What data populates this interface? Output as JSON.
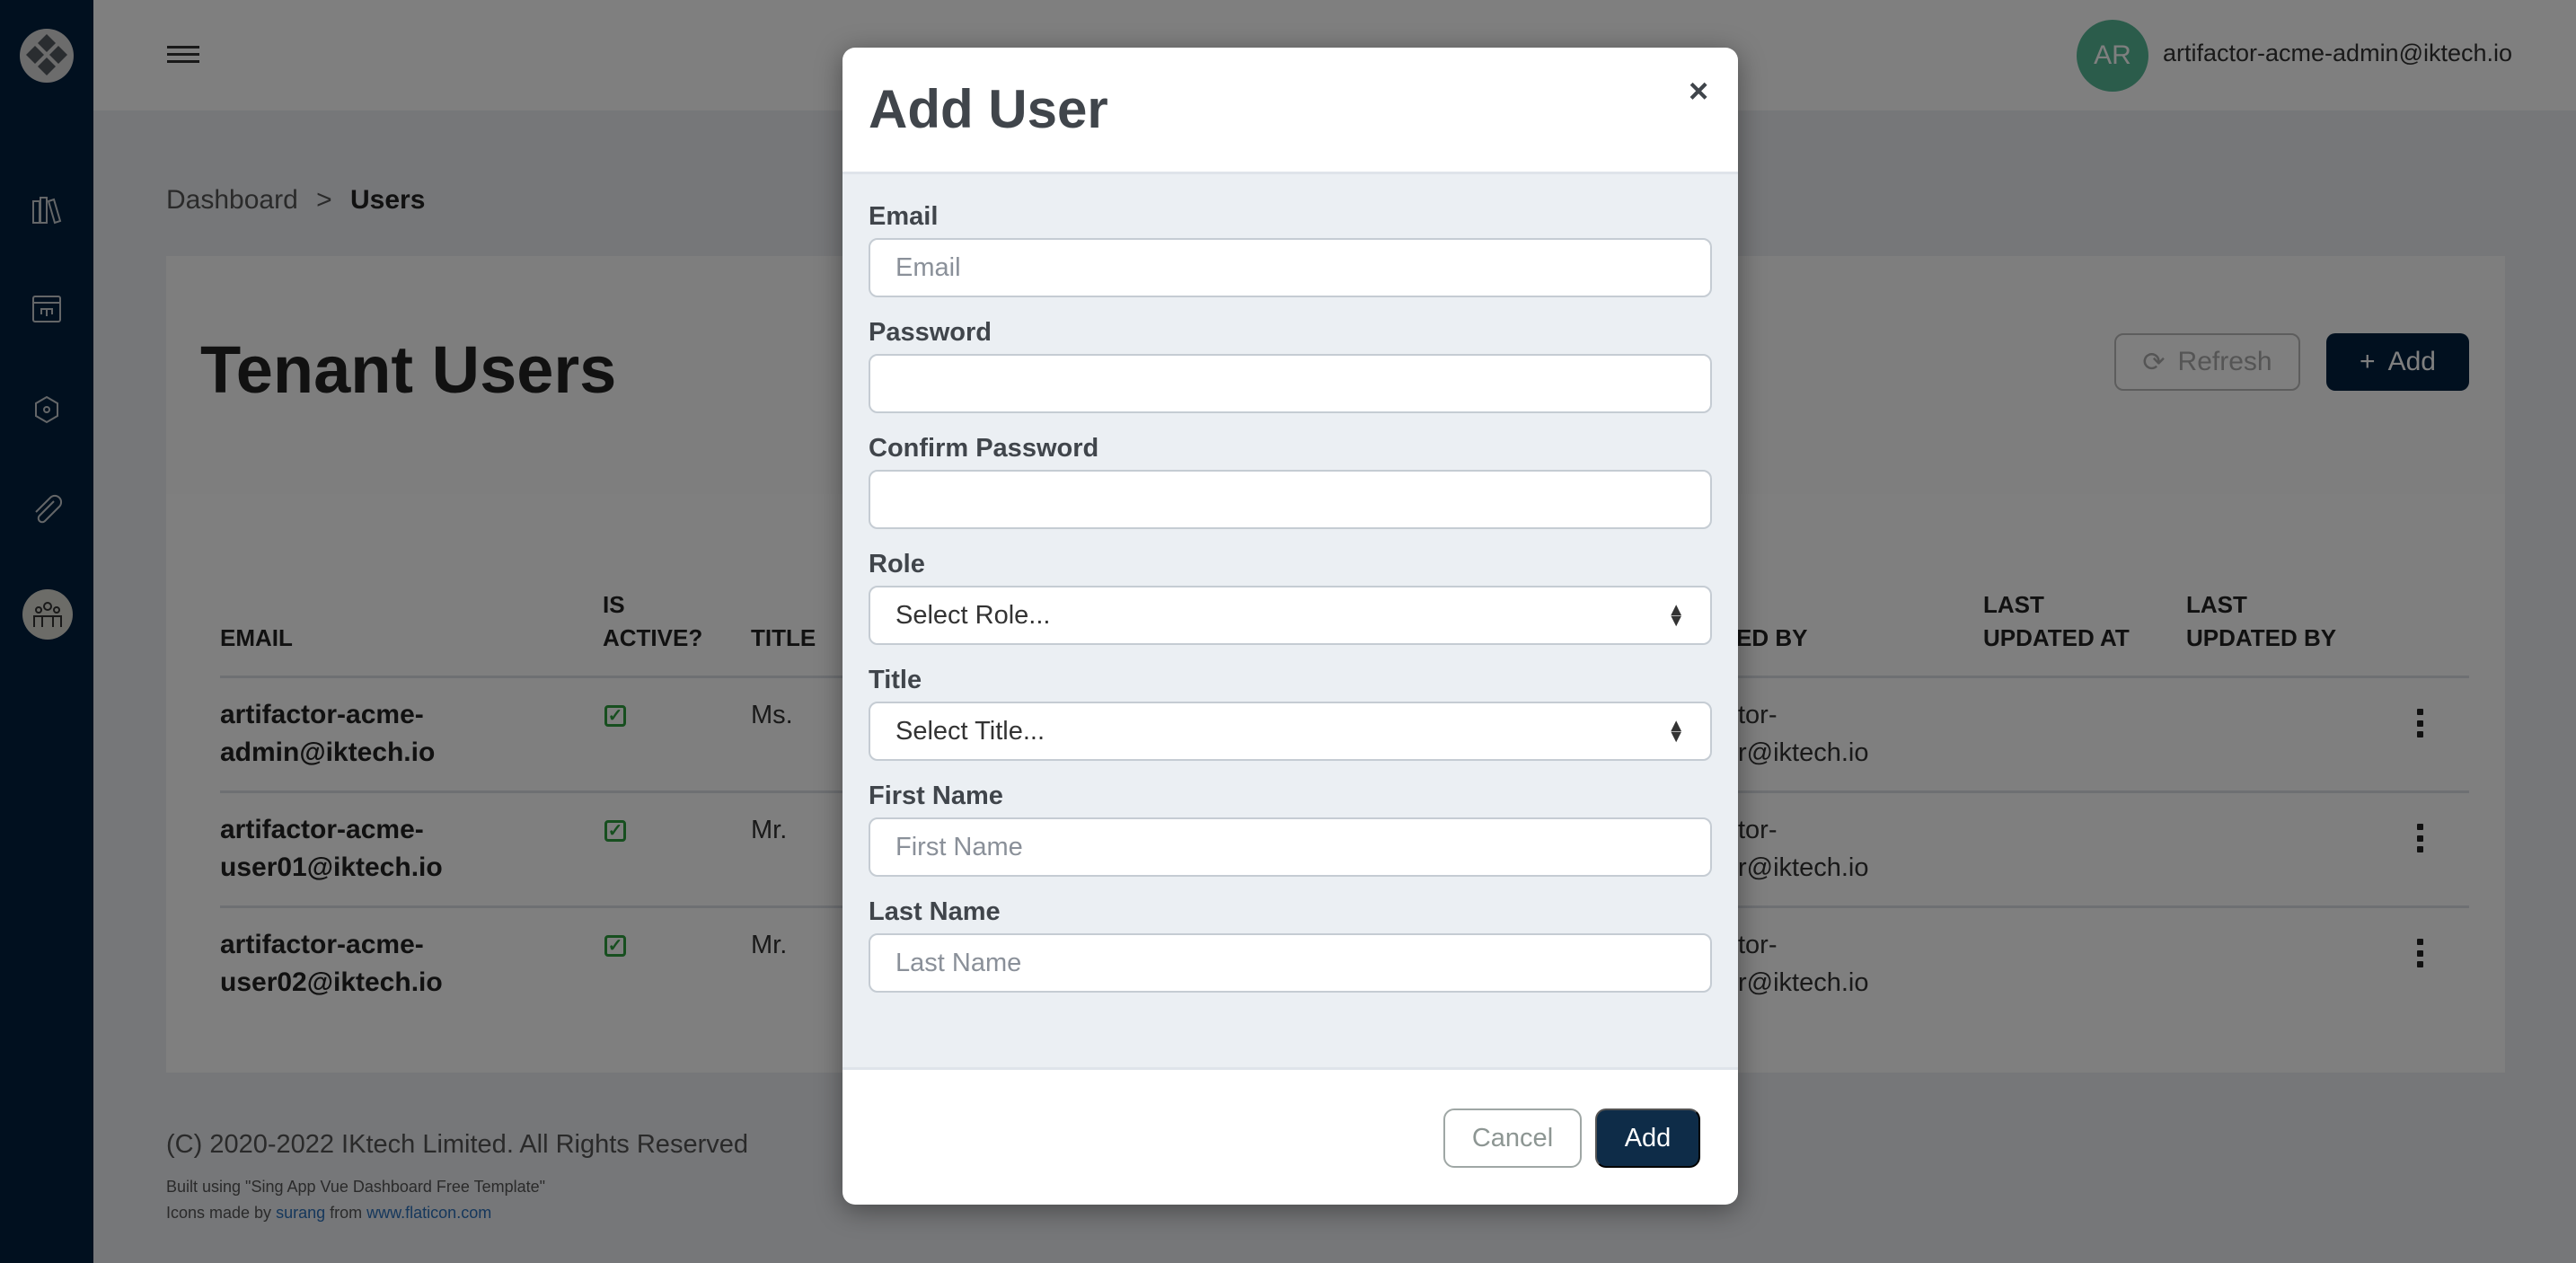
{
  "header": {
    "avatar_initials": "AR",
    "user_email": "artifactor-acme-admin@iktech.io"
  },
  "sidebar": {
    "items": [
      {
        "icon": "books-icon"
      },
      {
        "icon": "workflow-window-icon"
      },
      {
        "icon": "network-cube-icon"
      },
      {
        "icon": "paperclip-icon"
      },
      {
        "icon": "users-group-icon",
        "active": true
      }
    ]
  },
  "breadcrumb": {
    "parent": "Dashboard",
    "separator": ">",
    "current": "Users"
  },
  "page": {
    "title": "Tenant Users",
    "refresh_label": "Refresh",
    "add_label": "Add"
  },
  "table": {
    "headers": {
      "email": "EMAIL",
      "is_active_1": "IS",
      "is_active_2": "ACTIVE?",
      "title": "TITLE",
      "created_by_partial": "ED BY",
      "last_updated_at_1": "LAST",
      "last_updated_at_2": "UPDATED AT",
      "last_updated_by_1": "LAST",
      "last_updated_by_2": "UPDATED BY"
    },
    "rows": [
      {
        "email_1": "artifactor-acme-",
        "email_2": "admin@iktech.io",
        "active": true,
        "title": "Ms.",
        "created_1": "tor-",
        "created_2": "r@iktech.io"
      },
      {
        "email_1": "artifactor-acme-",
        "email_2": "user01@iktech.io",
        "active": true,
        "title": "Mr.",
        "created_1": "tor-",
        "created_2": "r@iktech.io"
      },
      {
        "email_1": "artifactor-acme-",
        "email_2": "user02@iktech.io",
        "active": true,
        "title": "Mr.",
        "created_1": "tor-",
        "created_2": "r@iktech.io"
      }
    ]
  },
  "footer": {
    "copyright": "(C) 2020-2022 IKtech Limited. All Rights Reserved",
    "built_using": "Built using \"Sing App Vue Dashboard Free Template\"",
    "icons_prefix": "Icons made by",
    "icons_author": "surang",
    "icons_from": "from",
    "icons_site": "www.flaticon.com"
  },
  "modal": {
    "title": "Add User",
    "close": "×",
    "fields": [
      {
        "label": "Email",
        "placeholder": "Email"
      },
      {
        "label": "Password",
        "placeholder": ""
      },
      {
        "label": "Confirm Password",
        "placeholder": ""
      },
      {
        "label": "Role",
        "value": "Select Role..."
      },
      {
        "label": "Title",
        "value": "Select Title..."
      },
      {
        "label": "First Name",
        "placeholder": "First Name"
      },
      {
        "label": "Last Name",
        "placeholder": "Last Name"
      }
    ],
    "cancel_label": "Cancel",
    "add_label": "Add"
  },
  "colors": {
    "sidebar": "#03213f",
    "primary": "#0e2c48",
    "avatar": "#56b897",
    "check": "#2e9e3e"
  }
}
